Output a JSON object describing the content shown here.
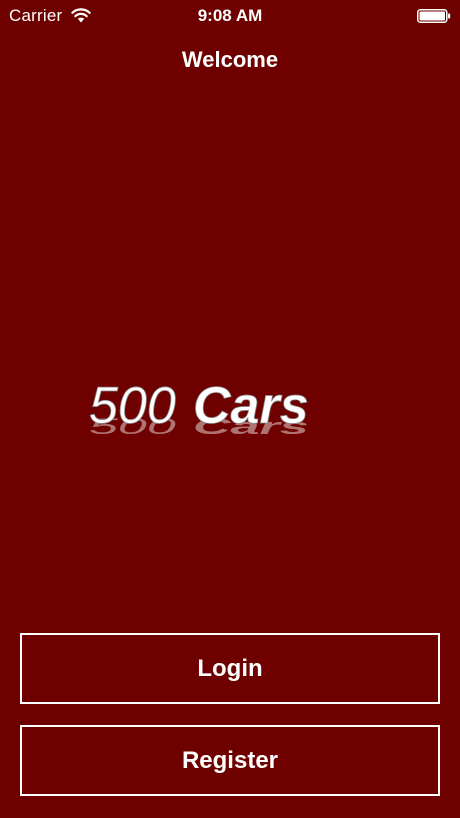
{
  "status_bar": {
    "carrier": "Carrier",
    "time": "9:08 AM",
    "wifi_icon": "wifi-icon",
    "battery_icon": "battery-full-icon"
  },
  "nav": {
    "title": "Welcome"
  },
  "logo": {
    "text_light": "500",
    "text_bold": "Cars"
  },
  "buttons": {
    "login_label": "Login",
    "register_label": "Register"
  },
  "colors": {
    "background": "#6e0000",
    "foreground": "#ffffff"
  }
}
